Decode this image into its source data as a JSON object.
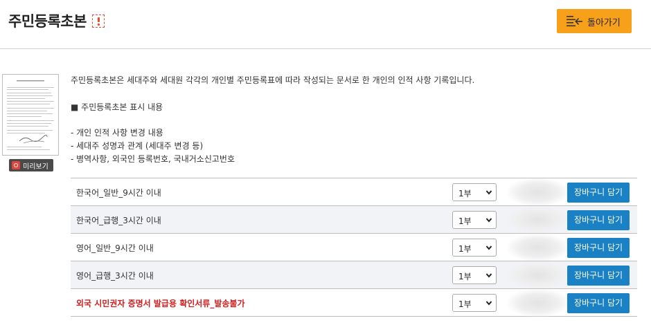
{
  "header": {
    "title": "주민등록초본",
    "back_label": "돌아가기"
  },
  "preview": {
    "label": "미리보기"
  },
  "description": {
    "intro": "주민등록초본은 세대주와 세대원 각각의 개인별 주민등록표에 따라 작성되는 문서로 한 개인의 인적 사항 기록입니다.",
    "section_title": "■ 주민등록초본 표시 내용",
    "items": [
      "- 개인 인적 사항 변경 내용",
      "- 세대주 성명과 관계 (세대주 변경 등)",
      "- 병역사항, 외국인 등록번호, 국내거소신고번호"
    ]
  },
  "options": [
    {
      "name": "한국어_일반_9시간 이내",
      "qty": "1부",
      "button": "장바구니 담기"
    },
    {
      "name": "한국어_급행_3시간 이내",
      "qty": "1부",
      "button": "장바구니 담기"
    },
    {
      "name": "영어_일반_9시간 이내",
      "qty": "1부",
      "button": "장바구니 담기"
    },
    {
      "name": "영어_급행_3시간 이내",
      "qty": "1부",
      "button": "장바구니 담기"
    },
    {
      "name": "외국 시민권자 증명서 발급용 확인서류_발송불가",
      "qty": "1부",
      "button": "장바구니 담기"
    }
  ],
  "colors": {
    "accent_orange": "#f7a11a",
    "button_blue": "#1a82c4",
    "warning_red": "#d21e1e"
  },
  "icons": [
    "alert-icon",
    "list-back-icon",
    "magnifier-icon",
    "chevron-down-icon"
  ]
}
